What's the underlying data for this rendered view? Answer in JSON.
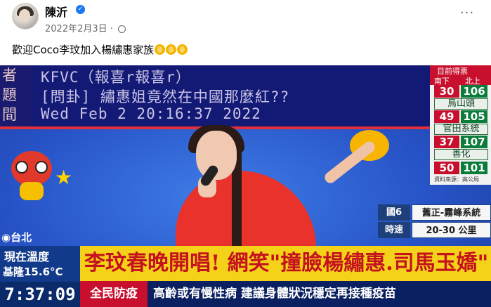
{
  "post": {
    "author": "陳沂",
    "verified_mark": "✓",
    "date": "2022年2月3日",
    "separator": "·",
    "more_menu": "···",
    "caption": "歡迎Coco李玟加入楊繡惠家族"
  },
  "icons": [
    "avatar",
    "verified-badge-icon",
    "globe-icon",
    "more-icon",
    "clap-emoji-icon"
  ],
  "video": {
    "crt": {
      "left_chars": [
        "者",
        "題",
        "間"
      ],
      "lines": [
        "KFVC（報喜r報喜r）",
        "[問卦] 繡惠姐竟然在中國那麼紅??",
        "Wed Feb  2 20:16:37 2022"
      ]
    },
    "poll": {
      "header_top": "目前得票",
      "header_left": "南下",
      "header_right": "北上",
      "rows": [
        {
          "red": "30",
          "green": "106",
          "name": "烏山頭"
        },
        {
          "red": "49",
          "green": "105",
          "name": "官田系統"
        },
        {
          "red": "37",
          "green": "107",
          "name": "善化"
        },
        {
          "red": "50",
          "green": "101",
          "name": ""
        }
      ],
      "source": "資料來源：高公局"
    },
    "traffic": {
      "road_label": "國6",
      "road_value": "舊正-霧峰系統",
      "time_label": "時速",
      "time_value": "20-30 公里"
    },
    "location": "◉台北",
    "weather_title": "現在溫度",
    "weather_value": "基隆15.6°C",
    "clock": "7:37:09",
    "headline": "李玟春晚開唱! 網笑\"撞臉楊繡惠.司馬玉嬌\"",
    "ticker_badge": "全民防疫",
    "ticker_text": "高齡或有慢性病 建議身體狀況穩定再接種疫苗"
  }
}
